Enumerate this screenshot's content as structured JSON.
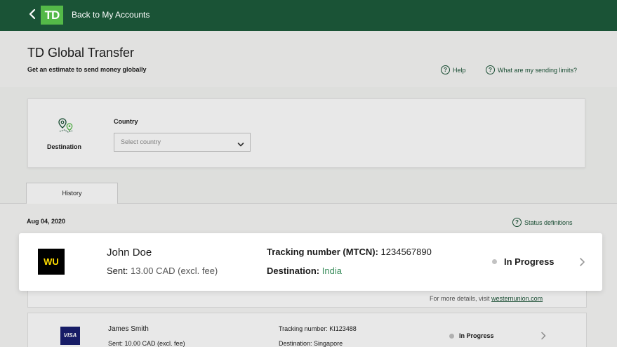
{
  "topbar": {
    "logo_text": "TD",
    "back_label": "Back to My Accounts"
  },
  "header": {
    "title": "TD Global Transfer",
    "subtitle": "Get an estimate to send money globally",
    "help_label": "Help",
    "limits_label": "What are my sending limits?"
  },
  "destination": {
    "label": "Destination",
    "country_label": "Country",
    "country_placeholder": "Select country"
  },
  "tabs": {
    "history_label": "History"
  },
  "history": {
    "date": "Aug 04, 2020",
    "status_definitions_label": "Status definitions",
    "more_details_prefix": "For more details, visit",
    "more_details_link": "westernunion.com",
    "transfers": [
      {
        "provider_logo": "WU",
        "name": "John Doe",
        "sent_label": "Sent:",
        "sent_value": "13.00 CAD (excl. fee)",
        "tracking_label": "Tracking number (MTCN):",
        "tracking_value": "1234567890",
        "destination_label": "Destination:",
        "destination_value": "India",
        "status": "In Progress"
      },
      {
        "provider_logo": "VISA",
        "name": "James Smith",
        "sent_label": "Sent:",
        "sent_value": "10.00 CAD (excl. fee)",
        "tracking_label": "Tracking number:",
        "tracking_value": "KI123488",
        "destination_label": "Destination:",
        "destination_value": "Singapore",
        "status": "In Progress"
      }
    ]
  },
  "colors": {
    "brand_dark_green": "#1a5336",
    "brand_light_green": "#54b948",
    "status_dot": "#c2c2c2"
  }
}
